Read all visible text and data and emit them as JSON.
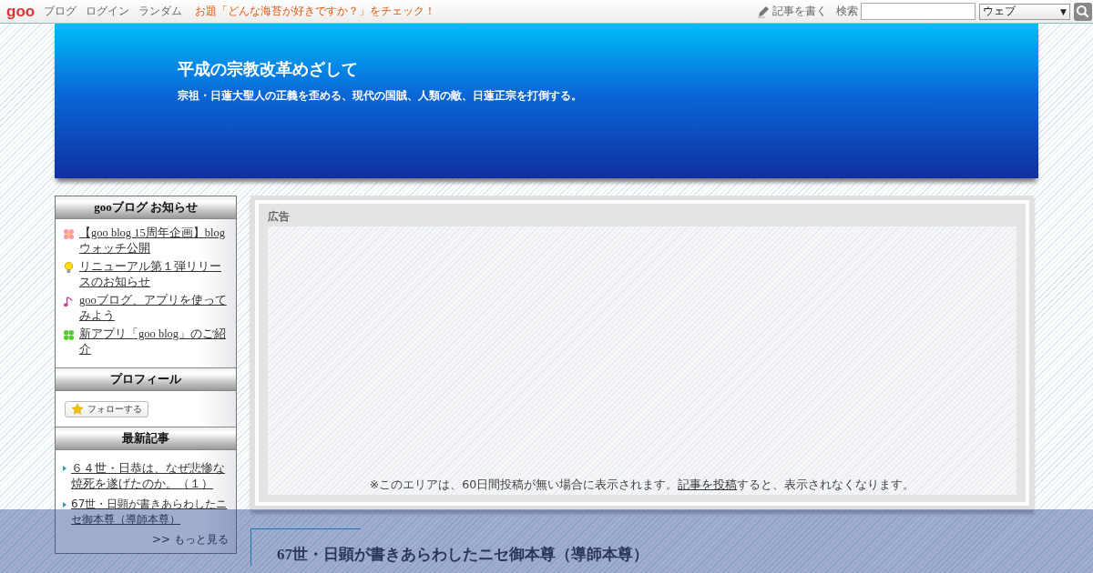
{
  "topbar": {
    "logo": "goo",
    "nav": [
      "ブログ",
      "ログイン",
      "ランダム"
    ],
    "promo": "お題「どんな海苔が好きですか？」をチェック！",
    "write_link": "記事を書く",
    "search_label": "検索",
    "search_scope": "ウェブ",
    "search_scope_arrow": "▼"
  },
  "header": {
    "title": "平成の宗教改革めざして",
    "subtitle": "宗祖・日蓮大聖人の正義を歪める、現代の国賊、人類の敵、日蓮正宗を打倒する。"
  },
  "sidebar": {
    "notices": {
      "title": "gooブログ お知らせ",
      "items": [
        {
          "kind": "flower",
          "text": "【goo blog 15周年企画】blogウォッチ公開"
        },
        {
          "kind": "bulb",
          "text": "リニューアル第１弾リリースのお知らせ"
        },
        {
          "kind": "note",
          "text": "gooブログ、アプリを使ってみよう"
        },
        {
          "kind": "clover",
          "text": "新アプリ「goo blog」のご紹介"
        }
      ]
    },
    "profile": {
      "title": "プロフィール",
      "follow_button": "フォローする"
    },
    "recent": {
      "title": "最新記事",
      "items": [
        "６４世・日恭は、なぜ悲惨な焼死を遂げたのか。（１）",
        "67世・日顕が書きあらわしたニセ御本尊（導師本尊）"
      ],
      "more": ">> もっと見る"
    }
  },
  "ad": {
    "label": "広告",
    "note_before": "※このエリアは、60日間投稿が無い場合に表示されます。",
    "note_link": "記事を投稿",
    "note_after": "すると、表示されなくなります。"
  },
  "article": {
    "title": "67世・日顕が書きあらわしたニセ御本尊（導師本尊）"
  }
}
